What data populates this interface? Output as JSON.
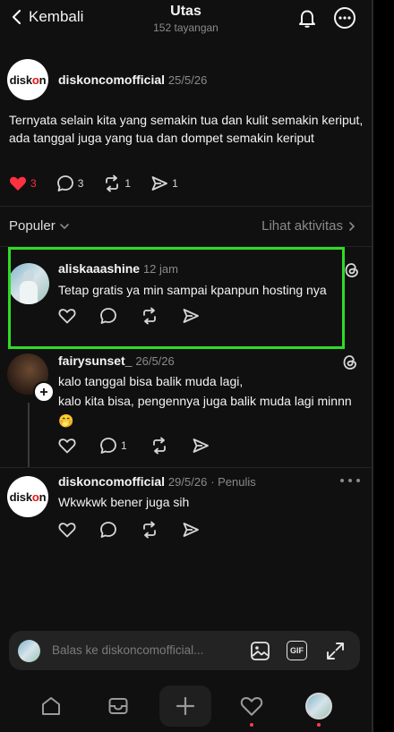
{
  "header": {
    "back_label": "Kembali",
    "title": "Utas",
    "views": "152 tayangan"
  },
  "main_post": {
    "username": "diskoncomofficial",
    "date": "25/5/26",
    "avatar_text_a": "disk",
    "avatar_text_b": "o",
    "avatar_text_c": "n",
    "text": "Ternyata selain kita yang semakin tua dan kulit semakin keriput, ada tanggal juga yang tua dan dompet semakin keriput",
    "likes": "3",
    "comments": "3",
    "reposts": "1",
    "shares": "1"
  },
  "section": {
    "populer": "Populer",
    "lihat": "Lihat aktivitas"
  },
  "replies": [
    {
      "username": "aliskaaashine",
      "time": "12 jam",
      "text": "Tetap gratis ya min sampai kpanpun hosting nya",
      "comments": ""
    },
    {
      "username": "fairysunset_",
      "time": "26/5/26",
      "line1": "kalo tanggal bisa balik muda lagi,",
      "line2": "kalo kita bisa, pengennya juga balik muda lagi minnn",
      "emoji": "🤭",
      "comments": "1"
    },
    {
      "username": "diskoncomofficial",
      "time": "29/5/26",
      "role": "· Penulis",
      "text": "Wkwkwk bener juga sih",
      "comments": ""
    }
  ],
  "reply_bar": {
    "placeholder": "Balas ke diskoncomofficial...",
    "gif": "GIF"
  },
  "colors": {
    "highlight": "#2fdc24",
    "like": "#ff3040",
    "background": "#101010"
  }
}
